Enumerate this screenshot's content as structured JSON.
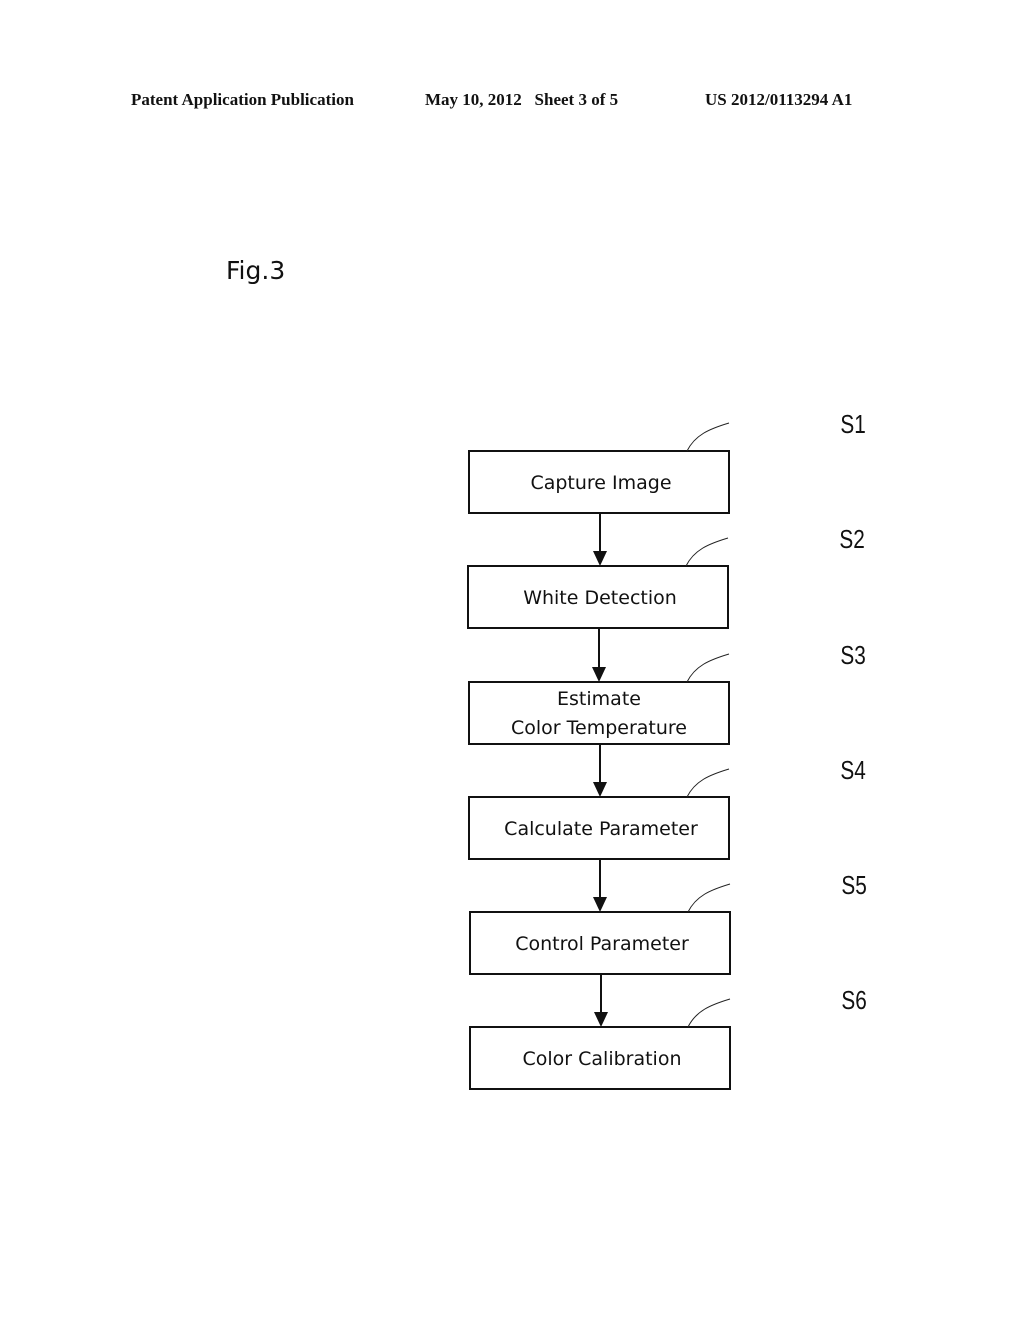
{
  "header": {
    "left": "Patent Application Publication",
    "middle": "May 10, 2012   Sheet 3 of 5",
    "right": "US 2012/0113294 A1"
  },
  "figure": {
    "label": "Fig.3",
    "steps": [
      {
        "id": "S1",
        "lines": [
          "Capture Image"
        ]
      },
      {
        "id": "S2",
        "lines": [
          "White Detection"
        ]
      },
      {
        "id": "S3",
        "lines": [
          "Estimate",
          "Color Temperature"
        ]
      },
      {
        "id": "S4",
        "lines": [
          "Calculate Parameter"
        ]
      },
      {
        "id": "S5",
        "lines": [
          "Control Parameter"
        ]
      },
      {
        "id": "S6",
        "lines": [
          "Color Calibration"
        ]
      }
    ]
  }
}
